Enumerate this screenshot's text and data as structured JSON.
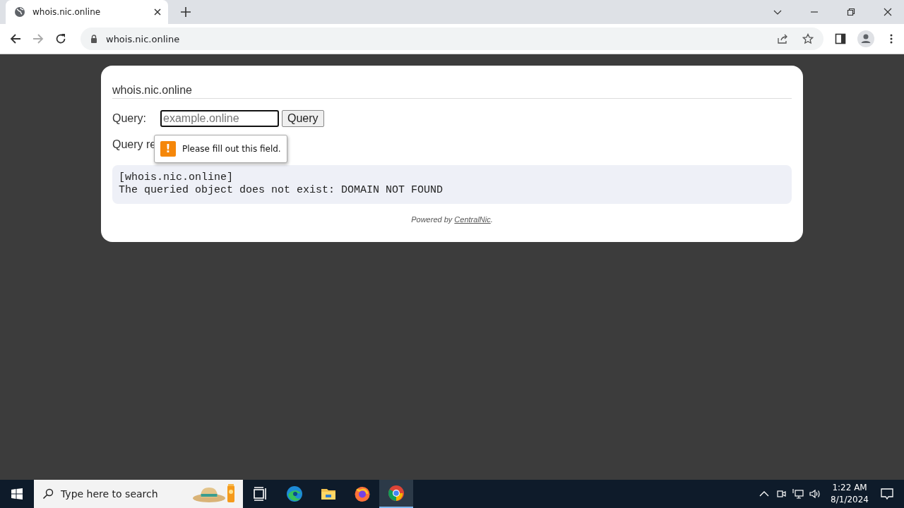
{
  "browser": {
    "tab": {
      "title": "whois.nic.online",
      "selected": true
    },
    "address": "whois.nic.online"
  },
  "page": {
    "heading": "whois.nic.online",
    "query_label": "Query:",
    "query_field": {
      "placeholder": "example.online"
    },
    "query_button": "Query",
    "result_label": "Query re",
    "tooltip": {
      "icon": "!",
      "text": "Please fill out this field."
    },
    "result_lines": [
      "[whois.nic.online]",
      "The queried object does not exist: DOMAIN NOT FOUND"
    ],
    "footer": {
      "prefix": "Powered by",
      "link": "CentralNic",
      "suffix": "."
    }
  },
  "taskbar": {
    "search_placeholder": "Type here to search",
    "apps": [
      {
        "kind": "taskview",
        "selected": false
      },
      {
        "kind": "edge",
        "selected": false
      },
      {
        "kind": "explorer",
        "selected": false
      },
      {
        "kind": "firefox",
        "selected": false
      },
      {
        "kind": "chrome",
        "selected": true
      }
    ],
    "time": "1:22 AM",
    "date": "8/1/2024"
  }
}
